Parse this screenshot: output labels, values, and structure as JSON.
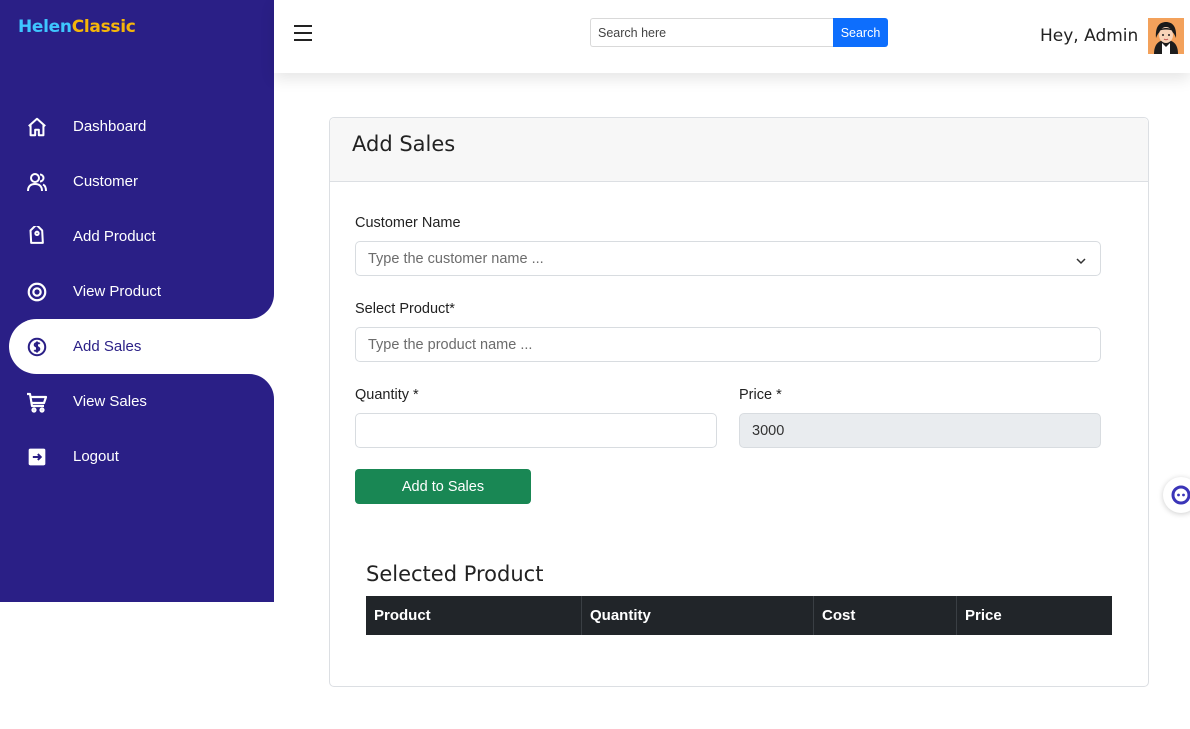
{
  "brand": {
    "part1": "Helen",
    "part2": "Classic"
  },
  "sidebar": {
    "items": [
      {
        "label": "Dashboard",
        "icon": "home-icon"
      },
      {
        "label": "Customer",
        "icon": "users-icon"
      },
      {
        "label": "Add Product",
        "icon": "tag-icon"
      },
      {
        "label": "View Product",
        "icon": "eye-icon"
      },
      {
        "label": "Add Sales",
        "icon": "dollar-coin-icon",
        "active": true
      },
      {
        "label": "View Sales",
        "icon": "cart-icon"
      },
      {
        "label": "Logout",
        "icon": "logout-icon"
      }
    ]
  },
  "header": {
    "search_placeholder": "Search here",
    "search_button": "Search",
    "greeting": "Hey, Admin"
  },
  "card": {
    "title": "Add Sales",
    "customer_label": "Customer Name",
    "customer_placeholder": "Type the customer name ...",
    "product_label": "Select Product*",
    "product_placeholder": "Type the product name ...",
    "quantity_label": "Quantity *",
    "quantity_value": "",
    "price_label": "Price *",
    "price_value": "3000",
    "add_button": "Add to Sales",
    "selected_title": "Selected Product",
    "table_headers": [
      "Product",
      "Quantity",
      "Cost",
      "Price"
    ]
  },
  "colors": {
    "sidebar_bg": "#2a1f86",
    "brand_blue": "#3ec6ff",
    "brand_gold": "#f5b50a",
    "primary": "#0d6efd",
    "success": "#198754",
    "table_head": "#212529"
  }
}
